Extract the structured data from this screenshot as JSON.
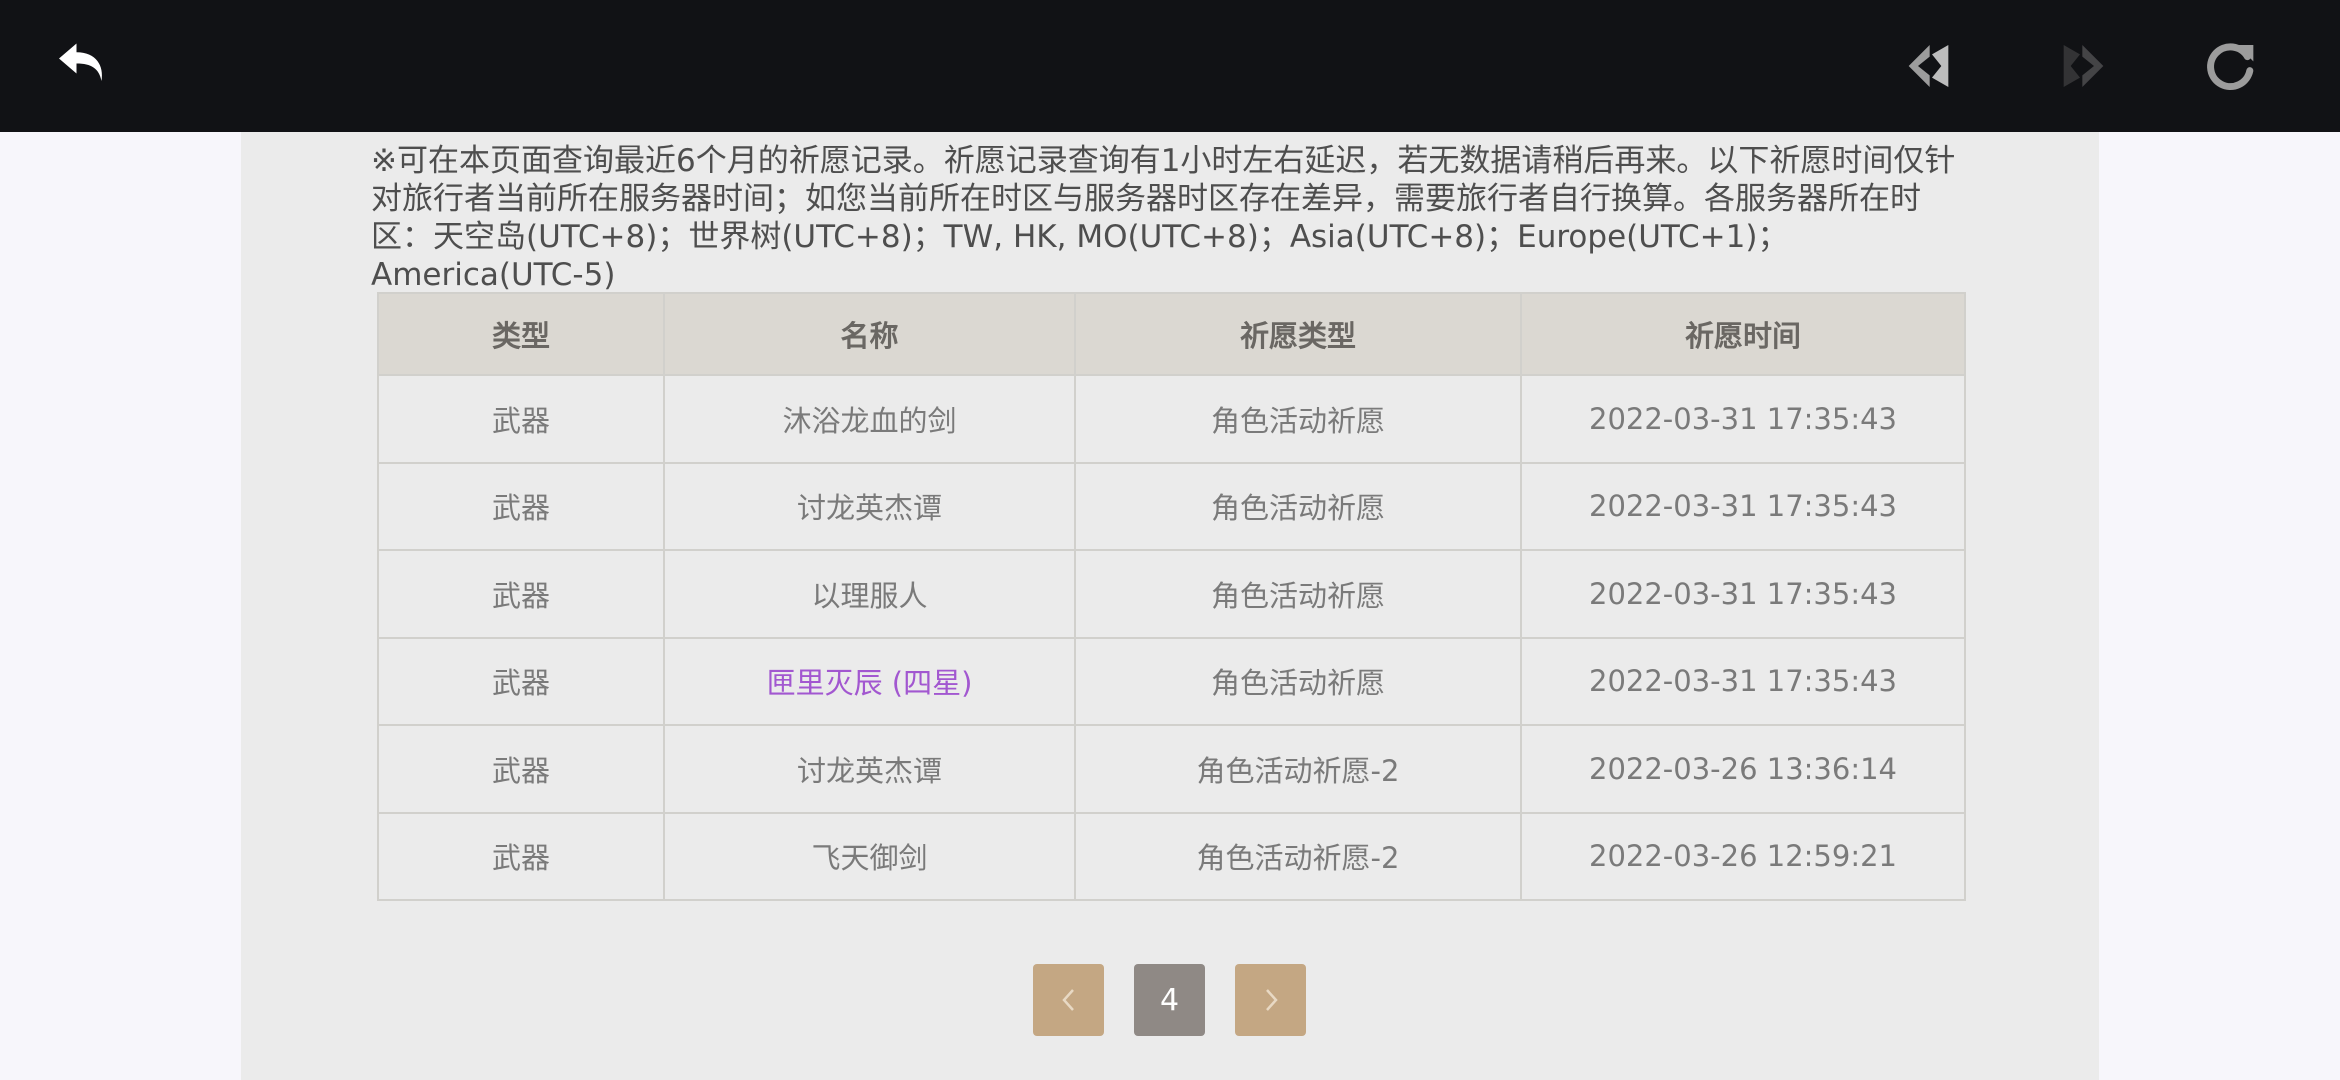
{
  "toolbar": {
    "back_icon": "back-arrow-icon",
    "prev_icon": "nav-back-icon",
    "next_icon": "nav-forward-icon",
    "refresh_icon": "refresh-icon"
  },
  "notice": "※可在本页面查询最近6个月的祈愿记录。祈愿记录查询有1小时左右延迟，若无数据请稍后再来。以下祈愿时间仅针对旅行者当前所在服务器时间；如您当前所在时区与服务器时区存在差异，需要旅行者自行换算。各服务器所在时区：天空岛(UTC+8)；世界树(UTC+8)；TW, HK, MO(UTC+8)；Asia(UTC+8)；Europe(UTC+1)；America(UTC-5)",
  "table": {
    "headers": [
      "类型",
      "名称",
      "祈愿类型",
      "祈愿时间"
    ],
    "rows": [
      {
        "type": "武器",
        "name": "沐浴龙血的剑",
        "wish_type": "角色活动祈愿",
        "time": "2022-03-31 17:35:43"
      },
      {
        "type": "武器",
        "name": "讨龙英杰谭",
        "wish_type": "角色活动祈愿",
        "time": "2022-03-31 17:35:43"
      },
      {
        "type": "武器",
        "name": "以理服人",
        "wish_type": "角色活动祈愿",
        "time": "2022-03-31 17:35:43"
      },
      {
        "type": "武器",
        "name": "匣里灭辰 (四星)",
        "wish_type": "角色活动祈愿",
        "time": "2022-03-31 17:35:43"
      },
      {
        "type": "武器",
        "name": "讨龙英杰谭",
        "wish_type": "角色活动祈愿-2",
        "time": "2022-03-26 13:36:14"
      },
      {
        "type": "武器",
        "name": "飞天御剑",
        "wish_type": "角色活动祈愿-2",
        "time": "2022-03-26 12:59:21"
      }
    ]
  },
  "pagination": {
    "current": "4",
    "prev_icon": "chevron-left-icon",
    "next_icon": "chevron-right-icon"
  },
  "colors": {
    "topbar": "#111215",
    "panel": "#ebebeb",
    "header_bg": "#dbd8d2",
    "four_star": "#a257d0",
    "pager_button": "#c4a783",
    "pager_current": "#8f8985"
  }
}
